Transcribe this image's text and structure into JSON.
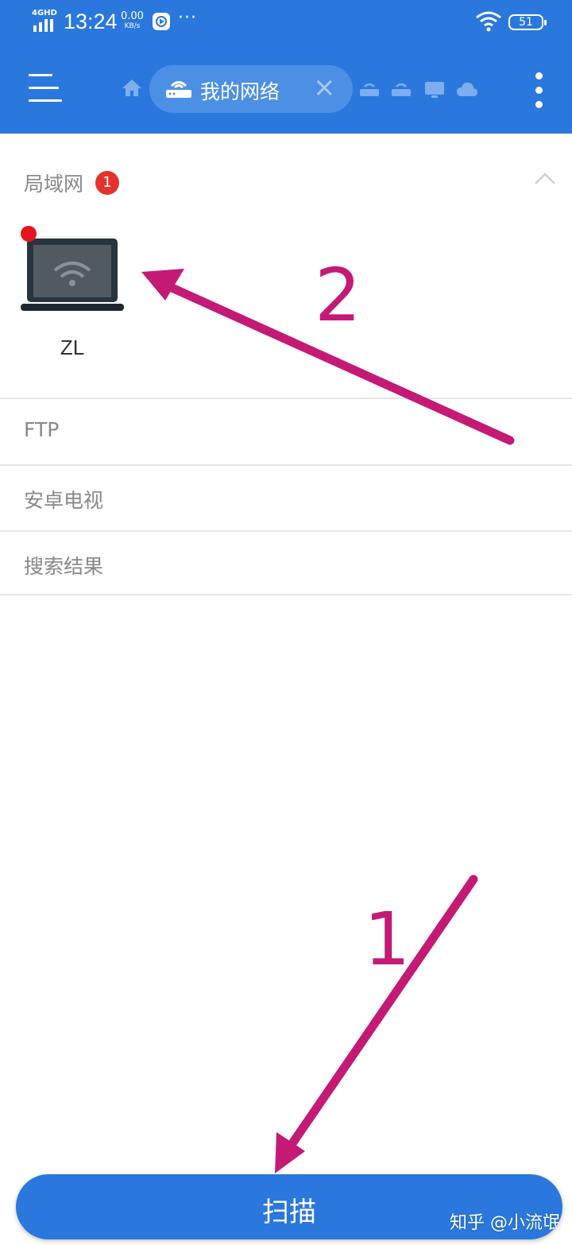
{
  "status_bar": {
    "network": "4GHD",
    "time": "13:24",
    "speed_value": "0.00",
    "speed_unit": "KB/s",
    "more": "···",
    "battery": "51"
  },
  "toolbar": {
    "active_tab_label": "我的网络"
  },
  "lan_section": {
    "title": "局域网",
    "badge_count": "1",
    "device": {
      "name": "ZL"
    }
  },
  "list_rows": [
    {
      "label": "FTP"
    },
    {
      "label": "安卓电视"
    },
    {
      "label": "搜索结果"
    }
  ],
  "scan_button": {
    "label": "扫描"
  },
  "annotations": {
    "first": "1",
    "second": "2"
  },
  "watermark": "知乎 @小流氓",
  "colors": {
    "primary": "#2a78dd",
    "annotation": "#c41a76",
    "badge": "#e5322d"
  }
}
